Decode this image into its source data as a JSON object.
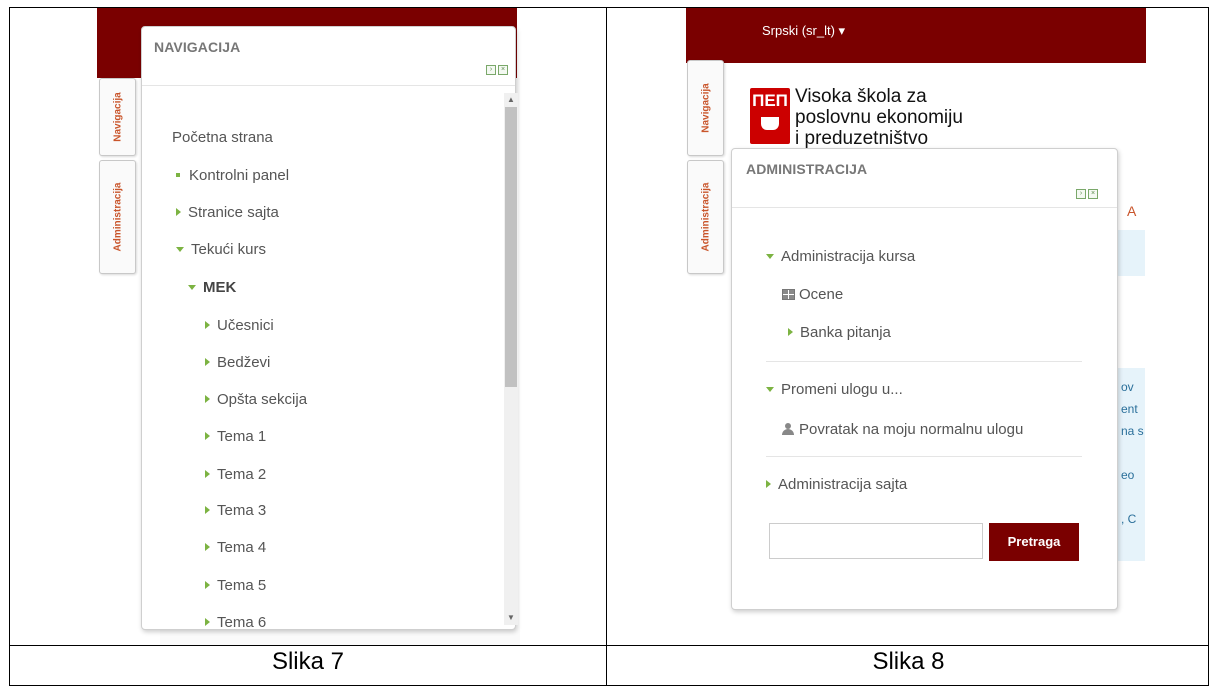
{
  "captions": {
    "left": "Slika 7",
    "right": "Slika 8"
  },
  "left": {
    "side_tabs": {
      "nav": "Navigacija",
      "admin": "Administracija"
    },
    "panel": {
      "title": "NAVIGACIJA",
      "items": [
        {
          "label": "Početna strana",
          "marker": "none",
          "bold": false
        },
        {
          "label": "Kontrolni panel",
          "marker": "square",
          "bold": false
        },
        {
          "label": "Stranice sajta",
          "marker": "right",
          "bold": false
        },
        {
          "label": "Tekući kurs",
          "marker": "down",
          "bold": false
        },
        {
          "label": "MEK",
          "marker": "down",
          "bold": true
        },
        {
          "label": "Učesnici",
          "marker": "right",
          "bold": false
        },
        {
          "label": "Bedževi",
          "marker": "right",
          "bold": false
        },
        {
          "label": "Opšta sekcija",
          "marker": "right",
          "bold": false
        },
        {
          "label": "Tema 1",
          "marker": "right",
          "bold": false
        },
        {
          "label": "Tema 2",
          "marker": "right",
          "bold": false
        },
        {
          "label": "Tema 3",
          "marker": "right",
          "bold": false
        },
        {
          "label": "Tema 4",
          "marker": "right",
          "bold": false
        },
        {
          "label": "Tema 5",
          "marker": "right",
          "bold": false
        },
        {
          "label": "Tema 6",
          "marker": "right",
          "bold": false
        }
      ]
    }
  },
  "right": {
    "language_menu": "Srpski (sr_lt) ▾",
    "side_tabs": {
      "nav": "Navigacija",
      "admin": "Administracija"
    },
    "logo": {
      "mark": "ПЕП",
      "lines": [
        "Visoka škola za",
        "poslovnu ekonomiju",
        "i preduzetništvo"
      ]
    },
    "bg_fragments": [
      "A",
      "ov",
      "ent",
      "na s",
      "eo",
      ", C"
    ],
    "panel": {
      "title": "ADMINISTRACIJA",
      "items": [
        {
          "label": "Administracija kursa",
          "marker": "down"
        },
        {
          "label": "Ocene",
          "marker": "grid"
        },
        {
          "label": "Banka pitanja",
          "marker": "right"
        },
        {
          "label": "Promeni ulogu u...",
          "marker": "down"
        },
        {
          "label": "Povratak na moju normalnu ulogu",
          "marker": "user"
        },
        {
          "label": "Administracija sajta",
          "marker": "right"
        }
      ],
      "search": {
        "value": "",
        "button": "Pretraga"
      }
    }
  },
  "colors": {
    "maroon": "#7a0000",
    "accent_green": "#7cb342",
    "tab_text": "#c9552b"
  }
}
